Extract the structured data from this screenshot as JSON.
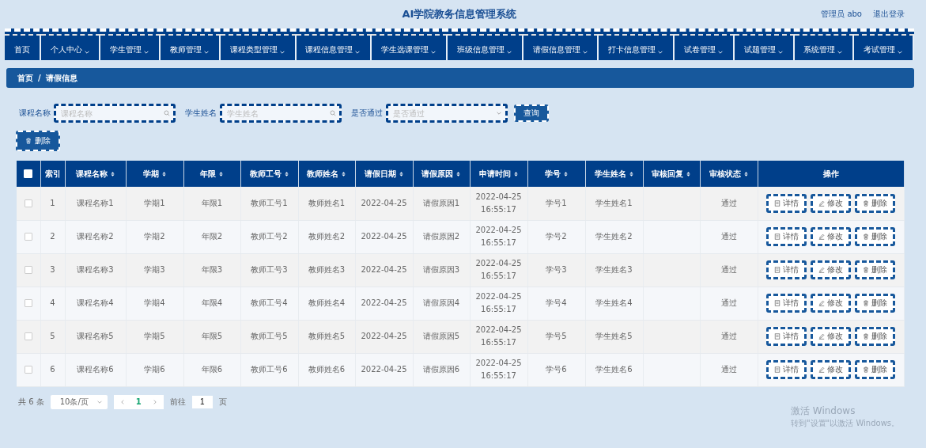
{
  "header": {
    "title": "AI学院教务信息管理系统",
    "user": "管理员 abo",
    "logout": "退出登录"
  },
  "nav": [
    {
      "label": "首页",
      "dropdown": false
    },
    {
      "label": "个人中心",
      "dropdown": true
    },
    {
      "label": "学生管理",
      "dropdown": true
    },
    {
      "label": "教师管理",
      "dropdown": true
    },
    {
      "label": "课程类型管理",
      "dropdown": true
    },
    {
      "label": "课程信息管理",
      "dropdown": true
    },
    {
      "label": "学生选课管理",
      "dropdown": true
    },
    {
      "label": "班级信息管理",
      "dropdown": true
    },
    {
      "label": "请假信息管理",
      "dropdown": true
    },
    {
      "label": "打卡信息管理",
      "dropdown": true
    },
    {
      "label": "试卷管理",
      "dropdown": true
    },
    {
      "label": "试题管理",
      "dropdown": true
    },
    {
      "label": "系统管理",
      "dropdown": true
    },
    {
      "label": "考试管理",
      "dropdown": true
    }
  ],
  "breadcrumb": [
    "首页",
    "/",
    "请假信息"
  ],
  "filters": [
    {
      "kind": "search",
      "label": "课程名称",
      "placeholder": "课程名称"
    },
    {
      "kind": "search",
      "label": "学生姓名",
      "placeholder": "学生姓名"
    },
    {
      "kind": "select",
      "label": "是否通过",
      "placeholder": "是否通过"
    }
  ],
  "query_button": "查询",
  "delete_button": "删除",
  "table": {
    "select_all_checked": false,
    "columns": [
      {
        "label": "索引",
        "sortable": false
      },
      {
        "label": "课程名称",
        "sortable": true
      },
      {
        "label": "学期",
        "sortable": true
      },
      {
        "label": "年限",
        "sortable": true
      },
      {
        "label": "教师工号",
        "sortable": true
      },
      {
        "label": "教师姓名",
        "sortable": true
      },
      {
        "label": "请假日期",
        "sortable": true
      },
      {
        "label": "请假原因",
        "sortable": true
      },
      {
        "label": "申请时间",
        "sortable": true
      },
      {
        "label": "学号",
        "sortable": true
      },
      {
        "label": "学生姓名",
        "sortable": true
      },
      {
        "label": "审核回复",
        "sortable": true
      },
      {
        "label": "审核状态",
        "sortable": true
      },
      {
        "label": "操作",
        "sortable": false
      }
    ],
    "rows": [
      {
        "checked": false,
        "cells": [
          "1",
          "课程名称1",
          "学期1",
          "年限1",
          "教师工号1",
          "教师姓名1",
          "2022-04-25",
          "请假原因1",
          "2022-04-25 16:55:17",
          "学号1",
          "学生姓名1",
          "",
          "通过"
        ],
        "actions": [
          "详情",
          "修改",
          "删除"
        ]
      },
      {
        "checked": false,
        "cells": [
          "2",
          "课程名称2",
          "学期2",
          "年限2",
          "教师工号2",
          "教师姓名2",
          "2022-04-25",
          "请假原因2",
          "2022-04-25 16:55:17",
          "学号2",
          "学生姓名2",
          "",
          "通过"
        ],
        "actions": [
          "详情",
          "修改",
          "删除"
        ]
      },
      {
        "checked": false,
        "cells": [
          "3",
          "课程名称3",
          "学期3",
          "年限3",
          "教师工号3",
          "教师姓名3",
          "2022-04-25",
          "请假原因3",
          "2022-04-25 16:55:17",
          "学号3",
          "学生姓名3",
          "",
          "通过"
        ],
        "actions": [
          "详情",
          "修改",
          "删除"
        ]
      },
      {
        "checked": false,
        "cells": [
          "4",
          "课程名称4",
          "学期4",
          "年限4",
          "教师工号4",
          "教师姓名4",
          "2022-04-25",
          "请假原因4",
          "2022-04-25 16:55:17",
          "学号4",
          "学生姓名4",
          "",
          "通过"
        ],
        "actions": [
          "详情",
          "修改",
          "删除"
        ]
      },
      {
        "checked": false,
        "cells": [
          "5",
          "课程名称5",
          "学期5",
          "年限5",
          "教师工号5",
          "教师姓名5",
          "2022-04-25",
          "请假原因5",
          "2022-04-25 16:55:17",
          "学号5",
          "学生姓名5",
          "",
          "通过"
        ],
        "actions": [
          "详情",
          "修改",
          "删除"
        ]
      },
      {
        "checked": false,
        "cells": [
          "6",
          "课程名称6",
          "学期6",
          "年限6",
          "教师工号6",
          "教师姓名6",
          "2022-04-25",
          "请假原因6",
          "2022-04-25 16:55:17",
          "学号6",
          "学生姓名6",
          "",
          "通过"
        ],
        "actions": [
          "详情",
          "修改",
          "删除"
        ]
      }
    ]
  },
  "pagination": {
    "total": "共 6 条",
    "page_size": "10条/页",
    "pages": [
      {
        "label": "1",
        "selected": true
      }
    ],
    "goto_label": "前往",
    "goto_value": "1",
    "goto_suffix": "页"
  },
  "os_notice": {
    "title": "激活 Windows",
    "subtitle": "转到\"设置\"以激活 Windows。"
  }
}
